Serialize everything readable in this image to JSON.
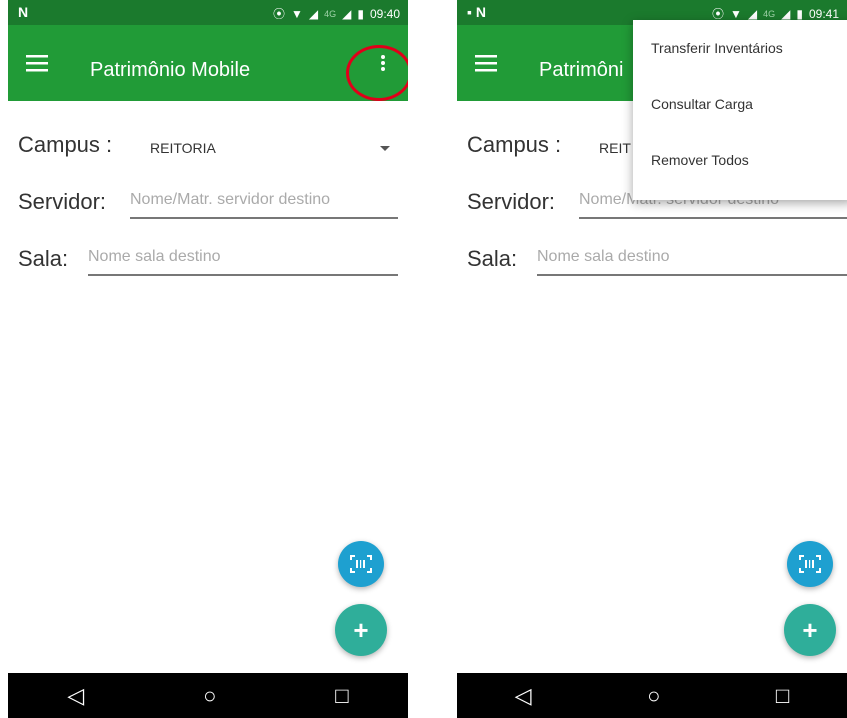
{
  "left": {
    "status": {
      "brand": "N",
      "time": "09:40",
      "signal_label": "4G"
    },
    "toolbar": {
      "title": "Patrimônio Mobile"
    },
    "form": {
      "campus_label": "Campus :",
      "campus_value": "REITORIA",
      "servidor_label": "Servidor:",
      "servidor_placeholder": "Nome/Matr. servidor destino",
      "sala_label": "Sala:",
      "sala_placeholder": "Nome sala destino"
    }
  },
  "right": {
    "status": {
      "brand": "N",
      "time": "09:41",
      "signal_label": "4G"
    },
    "toolbar": {
      "title": "Patrimôni"
    },
    "form": {
      "campus_label": "Campus :",
      "campus_value": "REIT",
      "servidor_label": "Servidor:",
      "servidor_placeholder": "Nome/Matr. servidor destino",
      "sala_label": "Sala:",
      "sala_placeholder": "Nome sala destino"
    },
    "menu": {
      "items": [
        "Transferir Inventários",
        "Consultar Carga",
        "Remover Todos"
      ]
    }
  },
  "nav": {
    "back": "◁",
    "home": "○",
    "recent": "□"
  },
  "colors": {
    "statusbar": "#1b7a2d",
    "toolbar": "#219b37",
    "fab_scan": "#1ea0d0",
    "fab_add": "#2fae9a",
    "highlight_circle": "#e0001a"
  },
  "fab_add_label": "+"
}
